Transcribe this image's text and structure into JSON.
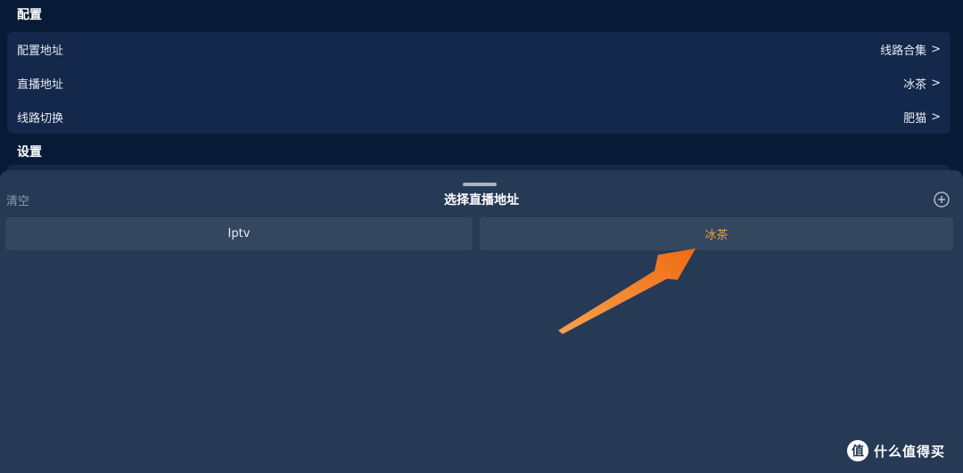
{
  "config": {
    "section_title": "配置",
    "rows": [
      {
        "label": "配置地址",
        "value": "线路合集"
      },
      {
        "label": "直播地址",
        "value": "冰茶"
      },
      {
        "label": "线路切换",
        "value": "肥猫"
      }
    ],
    "chevron": ">"
  },
  "settings": {
    "section_title": "设置"
  },
  "sheet": {
    "title": "选择直播地址",
    "clear_label": "清空",
    "add_icon": "plus-circle-icon",
    "options": [
      {
        "label": "Iptv",
        "selected": false
      },
      {
        "label": "冰茶",
        "selected": true
      }
    ]
  },
  "colors": {
    "background": "#071a36",
    "card": "#13284a",
    "sheet": "#263a55",
    "option": "#33475f",
    "selected_text": "#f0a232",
    "annotation_arrow": "#f5812a"
  },
  "watermark": {
    "text": "什么值得买",
    "logo": "值"
  }
}
